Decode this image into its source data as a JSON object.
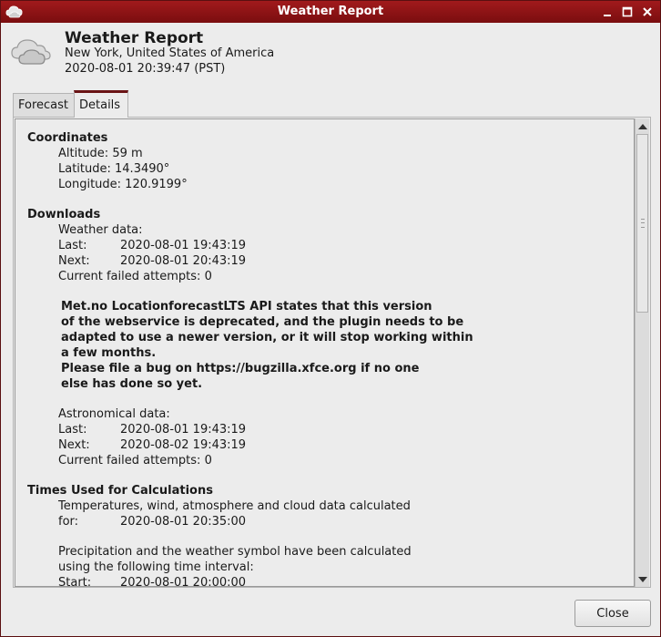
{
  "window": {
    "title": "Weather Report"
  },
  "header": {
    "title": "Weather Report",
    "location": "New York, United States of America",
    "datetime": "2020-08-01 20:39:47 (PST)"
  },
  "tabs": [
    {
      "label": "Forecast",
      "selected": false
    },
    {
      "label": "Details",
      "selected": true
    }
  ],
  "details": {
    "coordinates": {
      "heading": "Coordinates",
      "altitude": "Altitude: 59 m",
      "latitude": "Latitude: 14.3490°",
      "longitude": "Longitude: 120.9199°"
    },
    "downloads": {
      "heading": "Downloads",
      "weather_label": "Weather data:",
      "weather_last_label": "Last:",
      "weather_last_value": "2020-08-01 19:43:19",
      "weather_next_label": "Next:",
      "weather_next_value": "2020-08-01 20:43:19",
      "weather_failed": "Current failed attempts: 0",
      "warning": [
        "Met.no LocationforecastLTS API states that this version",
        "of the webservice is deprecated, and the plugin needs to be",
        "adapted to use a newer version, or it will stop working within",
        "a few months.",
        "Please file a bug on https://bugzilla.xfce.org if no one",
        "else has done so yet."
      ],
      "astro_label": "Astronomical data:",
      "astro_last_label": "Last:",
      "astro_last_value": "2020-08-01 19:43:19",
      "astro_next_label": "Next:",
      "astro_next_value": "2020-08-02 19:43:19",
      "astro_failed": "Current failed attempts: 0"
    },
    "times": {
      "heading": "Times Used for Calculations",
      "temp_line1": "Temperatures, wind, atmosphere and cloud data calculated",
      "temp_for_label": "for:",
      "temp_for_value": "2020-08-01 20:35:00",
      "precip_line1": "Precipitation and the weather symbol have been calculated",
      "precip_line2": "using the following time interval:",
      "precip_start_label": "Start:",
      "precip_start_value": "2020-08-01 20:00:00"
    }
  },
  "buttons": {
    "close": "Close"
  },
  "colors": {
    "titlebar": "#8e1416",
    "accent": "#6a1416"
  }
}
